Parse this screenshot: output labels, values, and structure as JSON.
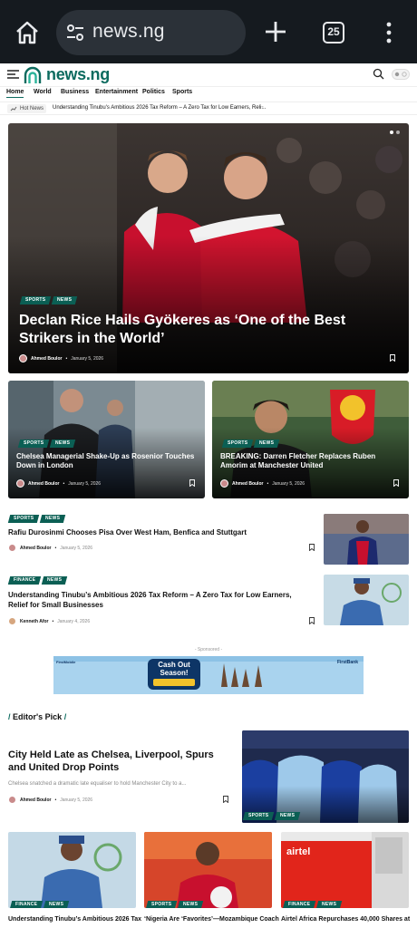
{
  "browser": {
    "url": "news.ng",
    "tab_count": "25"
  },
  "site": {
    "logo_text": "news.ng"
  },
  "nav": {
    "items": [
      "Home",
      "World",
      "Business",
      "Entertainment",
      "Politics",
      "Sports"
    ],
    "active": "Home"
  },
  "ticker": {
    "label": "Hot News",
    "headline": "Understanding Tinubu's Ambitious 2026 Tax Reform – A Zero Tax for Low Earners, Reli..."
  },
  "hero": {
    "tags": [
      "SPORTS",
      "NEWS"
    ],
    "title": "Declan Rice Hails Gyökeres as ‘One of the Best Strikers in the World’",
    "author": "Ahmed Boulor",
    "date": "January 5, 2026"
  },
  "cards": [
    {
      "tags": [
        "SPORTS",
        "NEWS"
      ],
      "title": "Chelsea Managerial Shake-Up as Rosenior Touches Down in London",
      "author": "Ahmed Boulor",
      "date": "January 5, 2026"
    },
    {
      "tags": [
        "SPORTS",
        "NEWS"
      ],
      "title": "BREAKING: Darren Fletcher Replaces Ruben Amorim at Manchester United",
      "author": "Ahmed Boulor",
      "date": "January 5, 2026"
    }
  ],
  "list": [
    {
      "tags": [
        "SPORTS",
        "NEWS"
      ],
      "title": "Rafiu Durosinmi Chooses Pisa Over West Ham, Benfica and Stuttgart",
      "author": "Ahmed Boulor",
      "date": "January 5, 2026"
    },
    {
      "tags": [
        "FINANCE",
        "NEWS"
      ],
      "title": "Understanding Tinubu’s Ambitious 2026 Tax Reform – A Zero Tax for Low Earners, Relief for Small Businesses",
      "author": "Kenneth Afor",
      "date": "January 4, 2026"
    }
  ],
  "sponsored": {
    "label": "- Sponsored -",
    "headline": "Cash Out Season!",
    "brand": "FirstBank",
    "brand_left": "FirstMobile"
  },
  "editors_pick": {
    "heading": "Editor's Pick",
    "title": "City Held Late as Chelsea, Liverpool, Spurs and United Drop Points",
    "excerpt": "Chelsea snatched a dramatic late equaliser to hold Manchester City to a...",
    "author": "Ahmed Boulor",
    "date": "January 5, 2026",
    "tags": [
      "SPORTS",
      "NEWS"
    ]
  },
  "bottom": [
    {
      "tags": [
        "FINANCE",
        "NEWS"
      ],
      "title": "Understanding Tinubu’s Ambitious 2026 Tax"
    },
    {
      "tags": [
        "SPORTS",
        "NEWS"
      ],
      "title": "‘Nigeria Are ‘Favorites’—Mozambique Coach"
    },
    {
      "tags": [
        "FINANCE",
        "NEWS"
      ],
      "title": "Airtel Africa Repurchases 40,000 Shares at"
    }
  ],
  "colors": {
    "brand": "#0d6b5f",
    "tag_bg": "#0b5f54",
    "browser_bg": "#151a1f"
  }
}
